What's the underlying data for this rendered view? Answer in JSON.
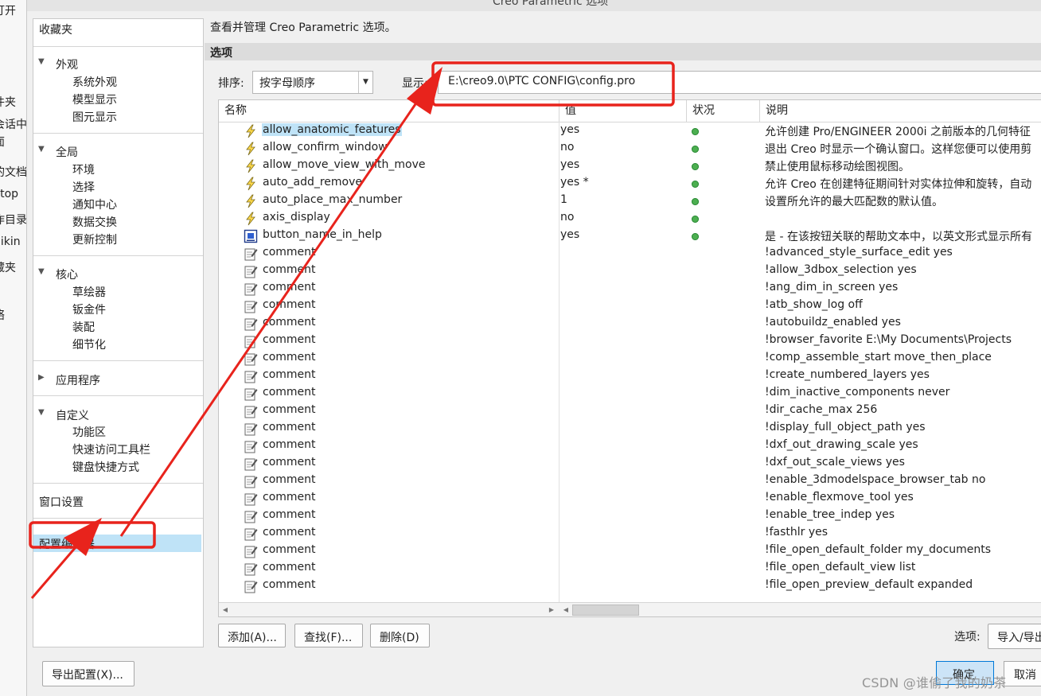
{
  "window": {
    "title": "Creo Parametric 选项"
  },
  "background_window": {
    "items": [
      "打开",
      "",
      "件夹",
      "会话中",
      "面",
      "的文档",
      "ktop",
      "作目录",
      "nikin",
      "藏夹",
      "",
      "络"
    ]
  },
  "nav": {
    "favorites": "收藏夹",
    "sections": [
      {
        "label": "外观",
        "items": [
          "系统外观",
          "模型显示",
          "图元显示"
        ]
      },
      {
        "label": "全局",
        "items": [
          "环境",
          "选择",
          "通知中心",
          "数据交换",
          "更新控制"
        ]
      },
      {
        "label": "核心",
        "items": [
          "草绘器",
          "钣金件",
          "装配",
          "细节化"
        ]
      },
      {
        "label": "应用程序",
        "items": []
      },
      {
        "label": "自定义",
        "items": [
          "功能区",
          "快速访问工具栏",
          "键盘快捷方式"
        ]
      }
    ],
    "window_settings": "窗口设置",
    "config_editor": "配置编辑器"
  },
  "main": {
    "description": "查看并管理 Creo Parametric 选项。",
    "options_header": "选项",
    "sort_label": "排序:",
    "sort_value": "按字母顺序",
    "show_label": "显示:",
    "show_value": "E:\\creo9.0\\PTC CONFIG\\config.pro"
  },
  "table": {
    "columns": [
      "名称",
      "值",
      "状况",
      "说明"
    ],
    "rows": [
      {
        "icon": "lightning-icon",
        "name": "allow_anatomic_features",
        "value": "yes",
        "status": true,
        "info": "允许创建 Pro/ENGINEER 2000i 之前版本的几何特征"
      },
      {
        "icon": "lightning-icon",
        "name": "allow_confirm_window",
        "value": "no",
        "status": true,
        "info": "退出 Creo 时显示一个确认窗口。这样您便可以使用剪"
      },
      {
        "icon": "lightning-icon",
        "name": "allow_move_view_with_move",
        "value": "yes",
        "status": true,
        "info": "禁止使用鼠标移动绘图视图。"
      },
      {
        "icon": "lightning-icon",
        "name": "auto_add_remove",
        "value": "yes *",
        "status": true,
        "info": "允许 Creo 在创建特征期间针对实体拉伸和旋转，自动"
      },
      {
        "icon": "lightning-icon",
        "name": "auto_place_max_number",
        "value": "1",
        "status": true,
        "info": "设置所允许的最大匹配数的默认值。"
      },
      {
        "icon": "lightning-icon",
        "name": "axis_display",
        "value": "no",
        "status": true,
        "info": ""
      },
      {
        "icon": "screen-icon",
        "name": "button_name_in_help",
        "value": "yes",
        "status": true,
        "info": "是 - 在该按钮关联的帮助文本中，以英文形式显示所有"
      },
      {
        "icon": "comment-icon",
        "name": "comment",
        "value": "",
        "status": false,
        "info": "!advanced_style_surface_edit yes"
      },
      {
        "icon": "comment-icon",
        "name": "comment",
        "value": "",
        "status": false,
        "info": "!allow_3dbox_selection yes"
      },
      {
        "icon": "comment-icon",
        "name": "comment",
        "value": "",
        "status": false,
        "info": "!ang_dim_in_screen yes"
      },
      {
        "icon": "comment-icon",
        "name": "comment",
        "value": "",
        "status": false,
        "info": "!atb_show_log off"
      },
      {
        "icon": "comment-icon",
        "name": "comment",
        "value": "",
        "status": false,
        "info": "!autobuildz_enabled yes"
      },
      {
        "icon": "comment-icon",
        "name": "comment",
        "value": "",
        "status": false,
        "info": "!browser_favorite E:\\My Documents\\Projects"
      },
      {
        "icon": "comment-icon",
        "name": "comment",
        "value": "",
        "status": false,
        "info": "!comp_assemble_start move_then_place"
      },
      {
        "icon": "comment-icon",
        "name": "comment",
        "value": "",
        "status": false,
        "info": "!create_numbered_layers yes"
      },
      {
        "icon": "comment-icon",
        "name": "comment",
        "value": "",
        "status": false,
        "info": "!dim_inactive_components never"
      },
      {
        "icon": "comment-icon",
        "name": "comment",
        "value": "",
        "status": false,
        "info": "!dir_cache_max 256"
      },
      {
        "icon": "comment-icon",
        "name": "comment",
        "value": "",
        "status": false,
        "info": "!display_full_object_path yes"
      },
      {
        "icon": "comment-icon",
        "name": "comment",
        "value": "",
        "status": false,
        "info": "!dxf_out_drawing_scale yes"
      },
      {
        "icon": "comment-icon",
        "name": "comment",
        "value": "",
        "status": false,
        "info": "!dxf_out_scale_views yes"
      },
      {
        "icon": "comment-icon",
        "name": "comment",
        "value": "",
        "status": false,
        "info": "!enable_3dmodelspace_browser_tab no"
      },
      {
        "icon": "comment-icon",
        "name": "comment",
        "value": "",
        "status": false,
        "info": "!enable_flexmove_tool yes"
      },
      {
        "icon": "comment-icon",
        "name": "comment",
        "value": "",
        "status": false,
        "info": "!enable_tree_indep yes"
      },
      {
        "icon": "comment-icon",
        "name": "comment",
        "value": "",
        "status": false,
        "info": "!fasthlr yes"
      },
      {
        "icon": "comment-icon",
        "name": "comment",
        "value": "",
        "status": false,
        "info": "!file_open_default_folder my_documents"
      },
      {
        "icon": "comment-icon",
        "name": "comment",
        "value": "",
        "status": false,
        "info": "!file_open_default_view list"
      },
      {
        "icon": "comment-icon",
        "name": "comment",
        "value": "",
        "status": false,
        "info": "!file_open_preview_default expanded"
      }
    ]
  },
  "buttons": {
    "add": "添加(A)...",
    "find": "查找(F)...",
    "delete": "删除(D)",
    "options_label": "选项:",
    "import_export": "导入/导出",
    "export_config": "导出配置(X)...",
    "ok": "确定",
    "cancel": "取消"
  },
  "watermark": "CSDN @谁偷了我的奶茶",
  "colors": {
    "selection": "#bfe3f7",
    "status_ok": "#4caf50",
    "annotation_red": "#e8231c",
    "ok_button": "#cce4f7"
  }
}
